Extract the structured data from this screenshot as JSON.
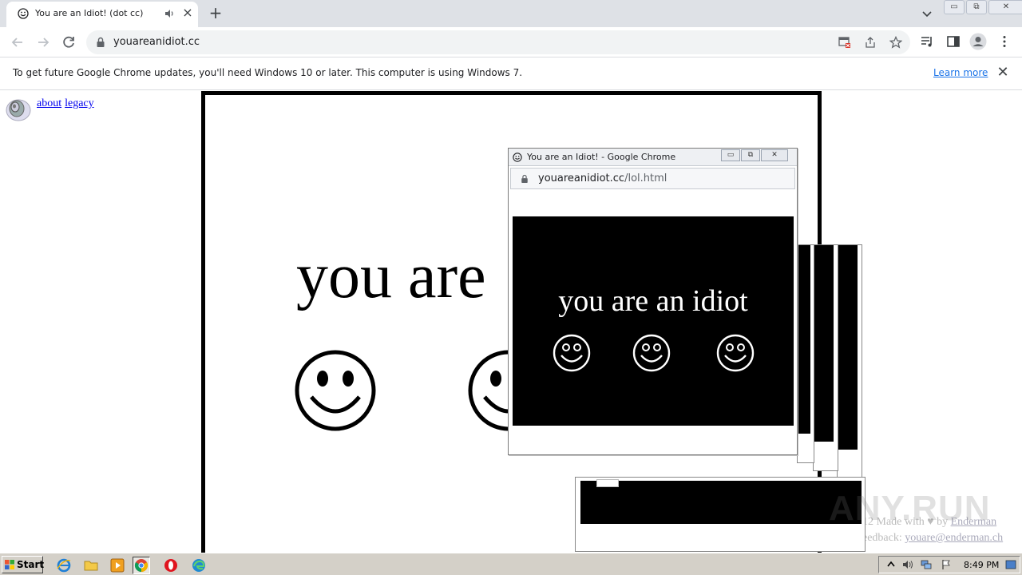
{
  "browser": {
    "tab": {
      "title": "You are an Idiot! (dot cc)"
    },
    "address": {
      "url": "youareanidiot.cc"
    },
    "infobar": {
      "message": "To get future Google Chrome updates, you'll need Windows 10 or later. This computer is using Windows 7.",
      "learn_more": "Learn more"
    },
    "window_buttons": {
      "minimize": "▭",
      "restore": "⧉",
      "close": "✕"
    }
  },
  "page": {
    "links": [
      {
        "label": "about"
      },
      {
        "label": "legacy"
      }
    ],
    "headline": "you are",
    "credit_line1_prefix": "12 Made with ♥ by ",
    "credit_line1_link": "Enderman",
    "credit_line2_prefix": "eedback: ",
    "credit_line2_link": "youare@enderman.ch"
  },
  "popup": {
    "title": "You are an Idiot! - Google Chrome",
    "url_host": "youareanidiot.cc",
    "url_path": "/lol.html",
    "headline": "you are an idiot",
    "smiley_count": 3
  },
  "watermark": {
    "text": "ANY.RUN"
  },
  "taskbar": {
    "start_label": "Start",
    "clock": "8:49 PM"
  },
  "colors": {
    "tabstrip": "#dee1e6",
    "link": "#1a73e8",
    "taskbar": "#d4d0c8"
  }
}
